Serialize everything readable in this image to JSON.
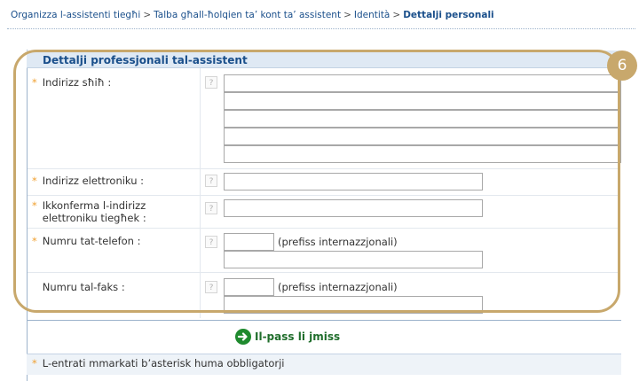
{
  "breadcrumb": {
    "items": [
      "Organizza l-assistenti tiegħi",
      "Talba għall-ħolqien ta’ kont ta’ assistent",
      "Identità"
    ],
    "current": "Dettalji personali",
    "separator": ">"
  },
  "panel": {
    "title": "Dettalji professjonali tal-assistent"
  },
  "fields": {
    "address": {
      "label": "Indirizz sħiħ :",
      "required": "*",
      "values": [
        "",
        "",
        "",
        "",
        ""
      ]
    },
    "email": {
      "label": "Indirizz elettroniku :",
      "required": "*",
      "value": ""
    },
    "email_confirm": {
      "label": "Ikkonferma l-indirizz elettroniku tiegħek :",
      "required": "*",
      "value": ""
    },
    "phone": {
      "label": "Numru tat-telefon :",
      "required": "*",
      "prefix_value": "",
      "prefix_hint": "(prefiss internazzjonali)",
      "value": ""
    },
    "fax": {
      "label": "Numru tal-faks :",
      "prefix_value": "",
      "prefix_hint": "(prefiss internazzjonali)",
      "value": ""
    }
  },
  "help_glyph": "?",
  "next_button": {
    "label": "Il-pass li jmiss",
    "icon": "arrow-right-circle-icon"
  },
  "footer_note": {
    "asterisk": "*",
    "text": "L-entrati mmarkati b’asterisk huma obbligatorji"
  },
  "annotation": {
    "number": "6",
    "color": "#c8a86c"
  },
  "colors": {
    "link": "#1a4f8b",
    "required": "#f0a030",
    "header_bg": "#dfe9f4",
    "next_icon": "#1f8a2e"
  }
}
